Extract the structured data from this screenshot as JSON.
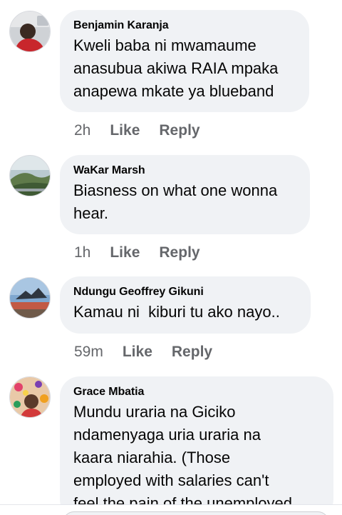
{
  "comments": [
    {
      "author": "Benjamin Karanja",
      "text": "Kweli baba ni mwamaume\nanasubua akiwa RAIA mpaka\nanapewa mkate ya blueband",
      "time": "2h",
      "like_label": "Like",
      "reply_label": "Reply"
    },
    {
      "author": "WaKar Marsh",
      "text": "Biasness on what one wonna\nhear.",
      "time": "1h",
      "like_label": "Like",
      "reply_label": "Reply"
    },
    {
      "author": "Ndungu Geoffrey Gikuni",
      "text": "Kamau ni  kiburi tu ako nayo..",
      "time": "59m",
      "like_label": "Like",
      "reply_label": "Reply"
    },
    {
      "author": "Grace Mbatia",
      "text": "Mundu uraria na Giciko\nndamenyaga uria uraria na\nkaara niarahia. (Those\nemployed with salaries can't\nfeel the pain of the unemployed"
    }
  ],
  "colors": {
    "bubble": "#f0f2f5",
    "meta_text": "#65676b",
    "body_text": "#050505"
  }
}
